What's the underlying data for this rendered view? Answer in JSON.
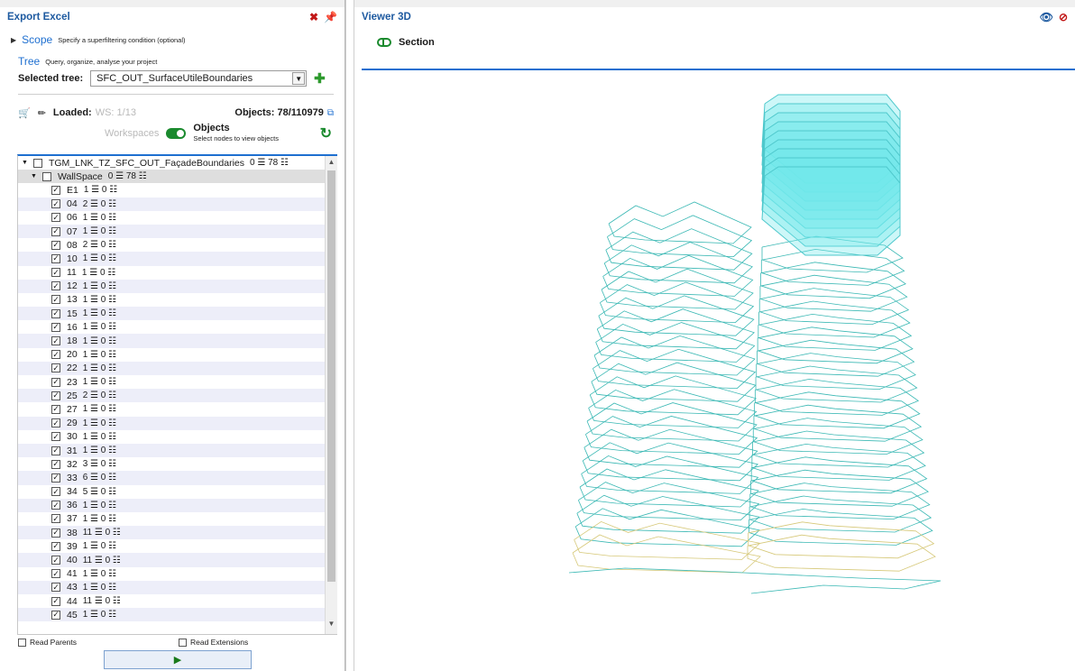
{
  "left_panel": {
    "title": "Export Excel",
    "close_icon": "close-icon",
    "pin_icon": "pin-icon"
  },
  "scope": {
    "label": "Scope",
    "description": "Specify a superfiltering condition (optional)"
  },
  "tree_section": {
    "label": "Tree",
    "description": "Query, organize, analyse your project",
    "selected_label": "Selected tree:",
    "selected_value": "SFC_OUT_SurfaceUtileBoundaries"
  },
  "loaded": {
    "label": "Loaded:",
    "ws_value": "WS: 1/13",
    "objects_label": "Objects: 78/110979"
  },
  "workspaces": {
    "label": "Workspaces",
    "objects_title": "Objects",
    "objects_hint": "Select nodes to view objects"
  },
  "tree": {
    "root": "TGM_LNK_TZ_SFC_OUT_FaçadeBoundaries",
    "root_count": "0 ☰ 78 ☷",
    "group": "WallSpace",
    "group_count": "0 ☰ 78 ☷",
    "items": [
      {
        "name": "E1",
        "count": "1 ☰ 0 ☷"
      },
      {
        "name": "04",
        "count": "2 ☰ 0 ☷"
      },
      {
        "name": "06",
        "count": "1 ☰ 0 ☷"
      },
      {
        "name": "07",
        "count": "1 ☰ 0 ☷"
      },
      {
        "name": "08",
        "count": "2 ☰ 0 ☷"
      },
      {
        "name": "10",
        "count": "1 ☰ 0 ☷"
      },
      {
        "name": "11",
        "count": "1 ☰ 0 ☷"
      },
      {
        "name": "12",
        "count": "1 ☰ 0 ☷"
      },
      {
        "name": "13",
        "count": "1 ☰ 0 ☷"
      },
      {
        "name": "15",
        "count": "1 ☰ 0 ☷"
      },
      {
        "name": "16",
        "count": "1 ☰ 0 ☷"
      },
      {
        "name": "18",
        "count": "1 ☰ 0 ☷"
      },
      {
        "name": "20",
        "count": "1 ☰ 0 ☷"
      },
      {
        "name": "22",
        "count": "1 ☰ 0 ☷"
      },
      {
        "name": "23",
        "count": "1 ☰ 0 ☷"
      },
      {
        "name": "25",
        "count": "2 ☰ 0 ☷"
      },
      {
        "name": "27",
        "count": "1 ☰ 0 ☷"
      },
      {
        "name": "29",
        "count": "1 ☰ 0 ☷"
      },
      {
        "name": "30",
        "count": "1 ☰ 0 ☷"
      },
      {
        "name": "31",
        "count": "1 ☰ 0 ☷"
      },
      {
        "name": "32",
        "count": "3 ☰ 0 ☷"
      },
      {
        "name": "33",
        "count": "6 ☰ 0 ☷"
      },
      {
        "name": "34",
        "count": "5 ☰ 0 ☷"
      },
      {
        "name": "36",
        "count": "1 ☰ 0 ☷"
      },
      {
        "name": "37",
        "count": "1 ☰ 0 ☷"
      },
      {
        "name": "38",
        "count": "11 ☰ 0 ☷"
      },
      {
        "name": "39",
        "count": "1 ☰ 0 ☷"
      },
      {
        "name": "40",
        "count": "11 ☰ 0 ☷"
      },
      {
        "name": "41",
        "count": "1 ☰ 0 ☷"
      },
      {
        "name": "43",
        "count": "1 ☰ 0 ☷"
      },
      {
        "name": "44",
        "count": "11 ☰ 0 ☷"
      },
      {
        "name": "45",
        "count": "1 ☰ 0 ☷"
      }
    ]
  },
  "options": {
    "read_parents": "Read Parents",
    "read_extensions": "Read Extensions"
  },
  "run_button": "▶",
  "viewer": {
    "title": "Viewer 3D",
    "section_label": "Section",
    "eye_icon": "eye-icon",
    "eye_off_icon": "eye-off-icon",
    "accent": "#1e6fd0",
    "line_color": "#3ab8b4",
    "solid_color": "#6fe8ea",
    "base_line_color": "#d6c878"
  }
}
